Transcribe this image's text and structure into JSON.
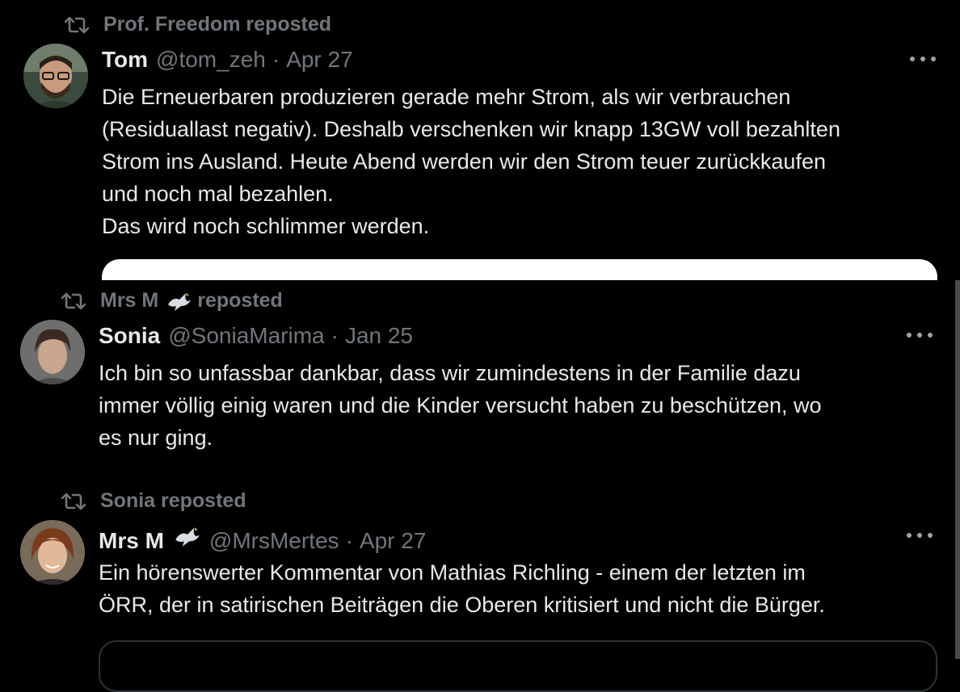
{
  "tweets": [
    {
      "reposted_by": "Prof. Freedom reposted",
      "name": "Tom",
      "handle": "@tom_zeh",
      "separator": "·",
      "date": "Apr 27",
      "text": "Die Erneuerbaren produzieren gerade mehr Strom, als wir verbrauchen\n(Residuallast negativ). Deshalb verschenken wir knapp 13GW voll bezahlten\nStrom ins Ausland. Heute Abend werden wir den Strom teuer zurückkaufen\nund noch mal bezahlen.\nDas wird noch schlimmer werden."
    },
    {
      "reposted_by_name": "Mrs M",
      "reposted_by_suffix": "reposted",
      "name": "Sonia",
      "handle": "@SoniaMarima",
      "separator": "·",
      "date": "Jan 25",
      "text": "Ich bin so unfassbar dankbar, dass wir zumindestens in der Familie dazu\nimmer völlig einig waren und die Kinder versucht haben zu beschützen, wo\nes nur ging."
    },
    {
      "reposted_by": "Sonia reposted",
      "name": "Mrs M",
      "handle": "@MrsMertes",
      "separator": "·",
      "date": "Apr 27",
      "text": "Ein hörenswerter Kommentar von Mathias Richling - einem der letzten im\nÖRR, der in satirischen Beiträgen die Oberen kritisiert und nicht die Bürger."
    }
  ],
  "colors": {
    "background": "#000000",
    "text": "#e7e9ea",
    "muted": "#71767b"
  },
  "icons": [
    "repost-icon",
    "dove-icon",
    "more-icon",
    "avatar"
  ]
}
